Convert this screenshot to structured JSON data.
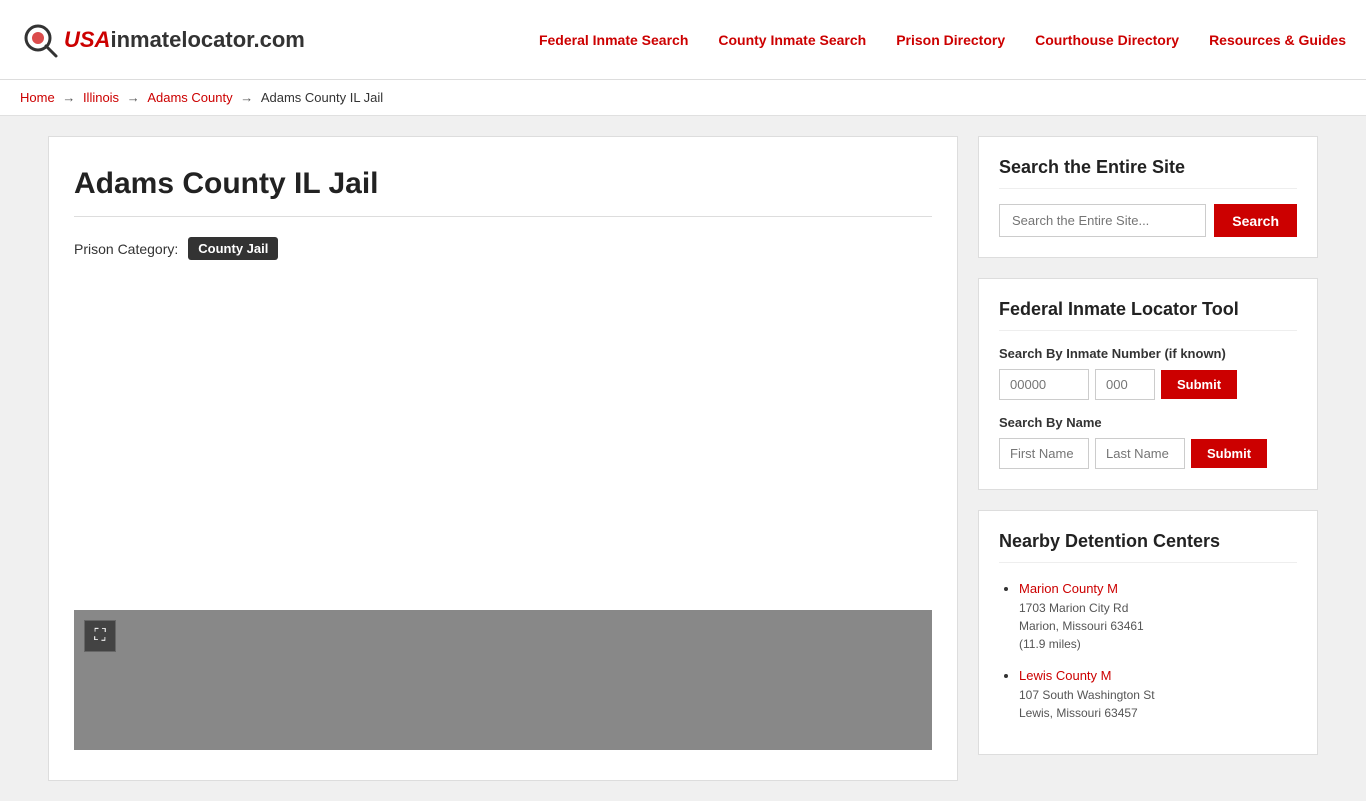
{
  "site": {
    "logo_usa": "USA",
    "logo_rest": "inmatelocator.com"
  },
  "nav": {
    "items": [
      {
        "id": "federal-inmate-search",
        "label": "Federal Inmate Search"
      },
      {
        "id": "county-inmate-search",
        "label": "County Inmate Search"
      },
      {
        "id": "prison-directory",
        "label": "Prison Directory"
      },
      {
        "id": "courthouse-directory",
        "label": "Courthouse Directory"
      },
      {
        "id": "resources-guides",
        "label": "Resources & Guides"
      }
    ]
  },
  "breadcrumb": {
    "home": "Home",
    "state": "Illinois",
    "county": "Adams County",
    "current": "Adams County IL Jail"
  },
  "main": {
    "page_title": "Adams County IL Jail",
    "prison_category_label": "Prison Category:",
    "prison_category_value": "County Jail"
  },
  "sidebar": {
    "search_widget": {
      "title": "Search the Entire Site",
      "placeholder": "Search the Entire Site...",
      "button_label": "Search"
    },
    "federal_locator": {
      "title": "Federal Inmate Locator Tool",
      "inmate_number_label": "Search By Inmate Number (if known)",
      "inmate_number_placeholder": "00000",
      "register_placeholder": "000",
      "submit_label": "Submit",
      "name_label": "Search By Name",
      "first_name_placeholder": "First Name",
      "last_name_placeholder": "Last Name",
      "submit_name_label": "Submit"
    },
    "nearby": {
      "title": "Nearby Detention Centers",
      "items": [
        {
          "name": "Marion County M",
          "address_line1": "1703 Marion City Rd",
          "address_line2": "Marion, Missouri 63461",
          "distance": "(11.9 miles)"
        },
        {
          "name": "Lewis County M",
          "address_line1": "107 South Washington St",
          "address_line2": "Lewis, Missouri 63457",
          "distance": ""
        }
      ]
    }
  },
  "map": {
    "expand_icon": "⛶"
  }
}
